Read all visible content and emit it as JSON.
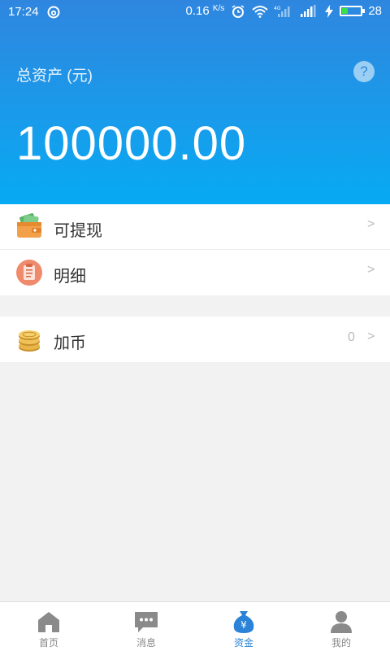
{
  "status_bar": {
    "time": "17:24",
    "net_speed": "0.16",
    "net_unit": "K/s",
    "signal_tag": "4G",
    "battery": "28"
  },
  "header": {
    "asset_label": "总资产 (元)",
    "help_glyph": "?",
    "amount": "100000.00"
  },
  "menu": {
    "withdraw_label": "可提现",
    "detail_label": "明细",
    "coin_label": "加币",
    "coin_value": "0",
    "chevron": ">"
  },
  "bottom_nav": {
    "items": [
      {
        "label": "首页",
        "icon": "home-icon"
      },
      {
        "label": "消息",
        "icon": "message-icon"
      },
      {
        "label": "资金",
        "icon": "money-bag-icon"
      },
      {
        "label": "我的",
        "icon": "user-icon"
      }
    ],
    "active": "资金"
  },
  "colors": {
    "header_top": "#2f86df",
    "header_bottom": "#07aaf3",
    "active_nav": "#2a83d6",
    "background": "#f2f2f2"
  }
}
